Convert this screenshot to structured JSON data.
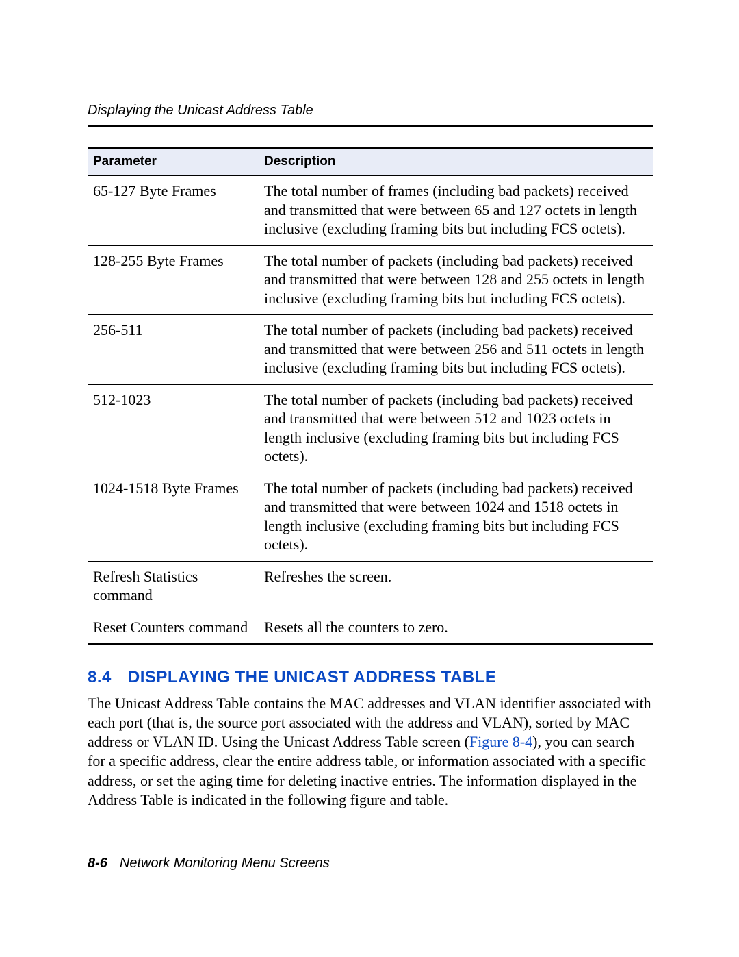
{
  "running_head": "Displaying the Unicast Address Table",
  "table": {
    "head_param": "Parameter",
    "head_desc": "Description",
    "rows": [
      {
        "param": "65-127 Byte Frames",
        "desc": "The total number of frames (including bad packets) received and transmitted that were between 65 and 127 octets in length inclusive (excluding framing bits but including FCS octets)."
      },
      {
        "param": "128-255 Byte Frames",
        "desc": "The total number of packets (including bad packets) received and transmitted that were between 128 and 255 octets in length inclusive (excluding framing bits but including FCS octets)."
      },
      {
        "param": "256-511",
        "desc": "The total number of packets (including bad packets) received and transmitted that were between 256 and 511 octets in length inclusive (excluding framing bits but including FCS octets)."
      },
      {
        "param": "512-1023",
        "desc": "The total number of packets (including bad packets) received and transmitted that were between 512 and 1023 octets in length inclusive (excluding framing bits but including FCS octets)."
      },
      {
        "param": "1024-1518 Byte Frames",
        "desc": "The total number of packets (including bad packets) received and transmitted that were between 1024 and 1518 octets in length inclusive (excluding framing bits but including FCS octets)."
      },
      {
        "param": "Refresh Statistics command",
        "desc": "Refreshes the screen."
      },
      {
        "param": "Reset Counters command",
        "desc": "Resets all the counters to zero."
      }
    ]
  },
  "section": {
    "number": "8.4",
    "title": "DISPLAYING THE UNICAST ADDRESS TABLE",
    "body_pre": "The Unicast Address Table contains the MAC addresses and VLAN identifier associated with each port (that is, the source port associated with the address and VLAN), sorted by MAC address or VLAN ID. Using the Unicast Address Table screen (",
    "figref": "Figure 8-4",
    "body_post": "), you can search for a specific address, clear the entire address table, or information associated with a specific address, or set the aging time for deleting inactive entries. The information displayed in the Address Table is indicated in the following figure and table."
  },
  "footer": {
    "page": "8-6",
    "title": "Network Monitoring Menu Screens"
  }
}
